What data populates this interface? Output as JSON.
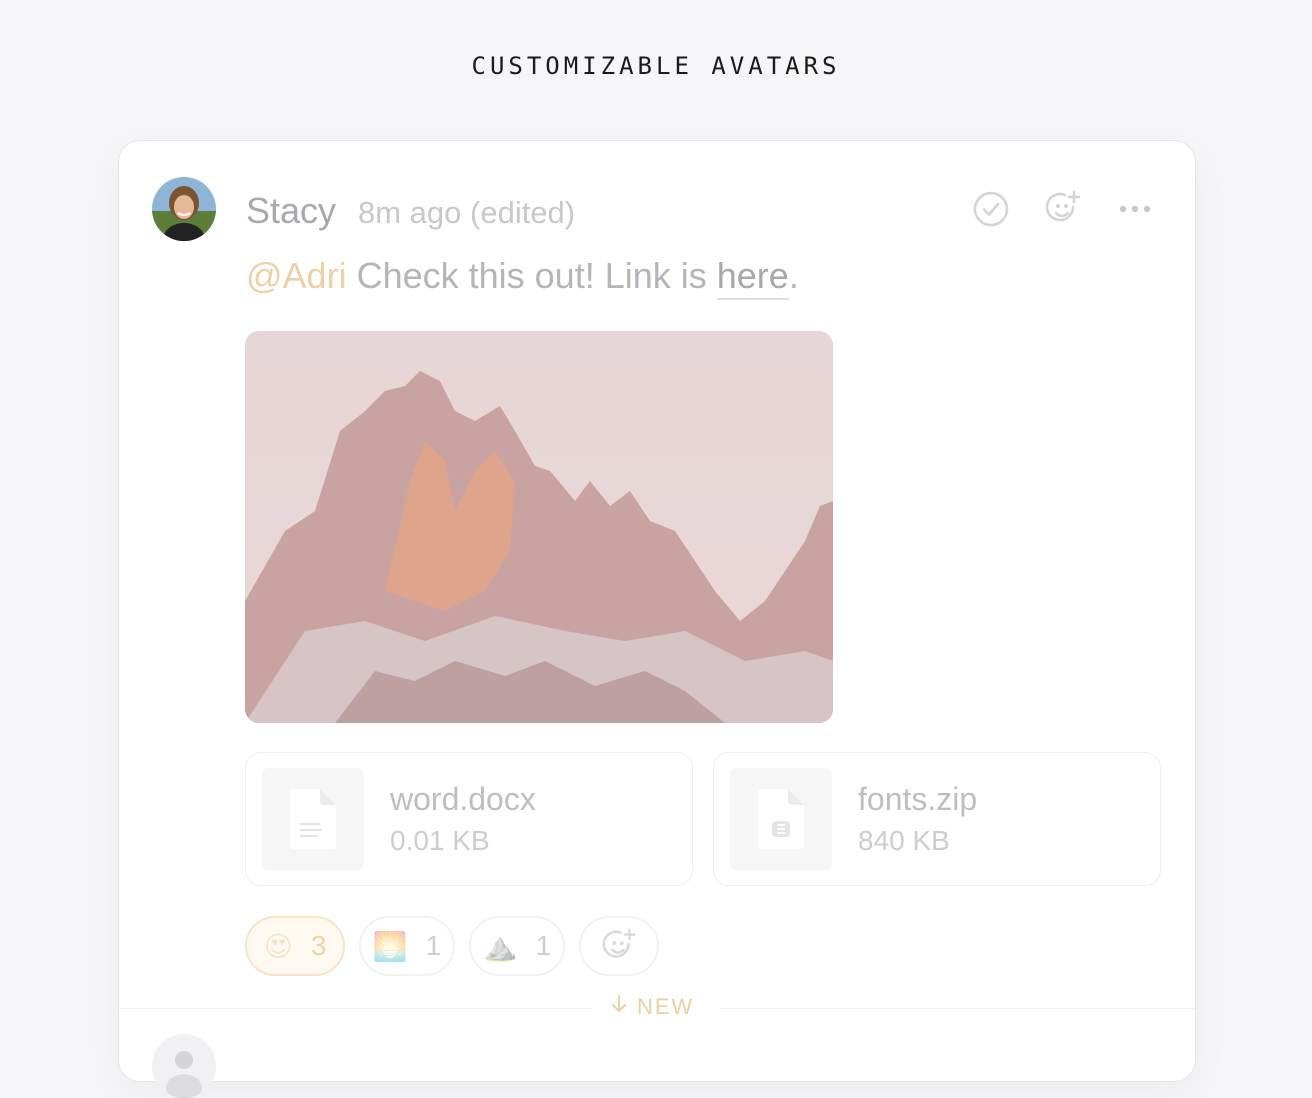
{
  "heading": "CUSTOMIZABLE AVATARS",
  "message": {
    "author": "Stacy",
    "time": "8m ago (edited)",
    "mention": "@Adri",
    "text": " Check this out! Link is ",
    "link_text": "here",
    "trailing": "."
  },
  "actions": [
    {
      "name": "check-circle-icon"
    },
    {
      "name": "add-reaction-icon"
    },
    {
      "name": "more-icon"
    }
  ],
  "attachments": [
    {
      "name": "word.docx",
      "size": "0.01 KB",
      "icon": "document-icon"
    },
    {
      "name": "fonts.zip",
      "size": "840 KB",
      "icon": "zip-icon"
    }
  ],
  "reactions": [
    {
      "emoji": "😍",
      "count": "3",
      "active": true
    },
    {
      "emoji": "🌅",
      "count": "1",
      "active": false
    },
    {
      "emoji": "⛰️",
      "count": "1",
      "active": false
    }
  ],
  "new_divider": {
    "label": "NEW"
  },
  "colors": {
    "accent": "#ecd0a8",
    "muted_text": "#b4b4b9"
  }
}
